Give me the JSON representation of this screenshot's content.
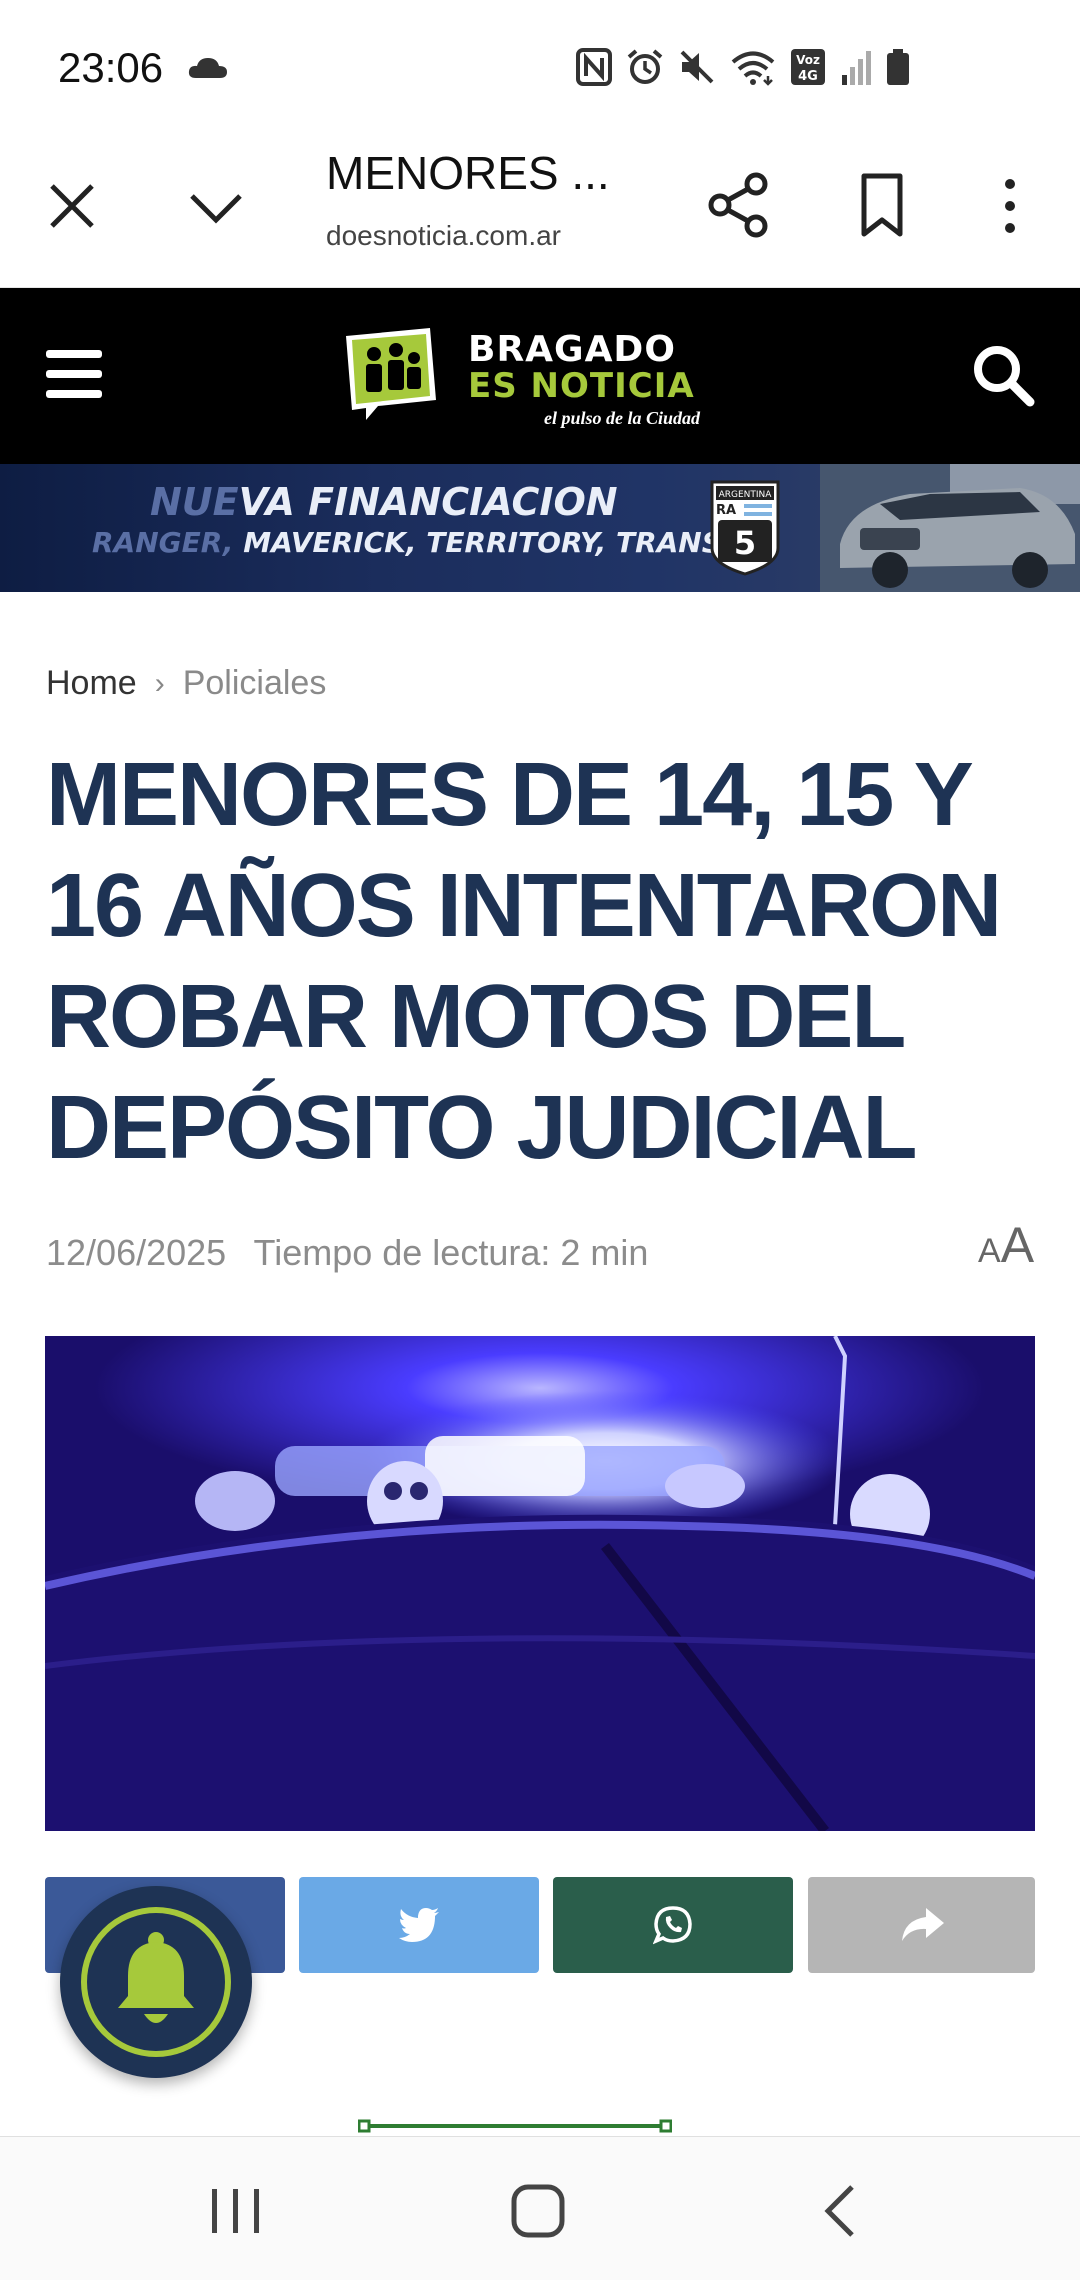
{
  "status_bar": {
    "time": "23:06",
    "icons": [
      "cloud-icon",
      "nfc-icon",
      "alarm-icon",
      "mute-icon",
      "wifi-icon",
      "volte-4g-icon",
      "signal-icon",
      "battery-icon"
    ],
    "volte_text": "Voz 4G"
  },
  "browser": {
    "title": "MENORES ...",
    "url": "doesnoticia.com.ar"
  },
  "site": {
    "logo_name": "BRAGADO",
    "logo_sub": "ES NOTICIA",
    "logo_tagline": "el pulso de la Ciudad",
    "brand_color": "#a6c93b",
    "header_color": "#000000"
  },
  "ad": {
    "line1_fade": "NUE",
    "line1": "VA FINANCIACION",
    "line2_fade": "RANGER, ",
    "line2": "MAVERICK, TERRITORY, TRANSIT",
    "route_country": "ARGENTINA",
    "route_code": "RA",
    "route_number": "5"
  },
  "breadcrumb": {
    "home": "Home",
    "separator": "›",
    "category": "Policiales"
  },
  "article": {
    "headline": "MENORES DE 14, 15 Y 16 AÑOS INTENTARON ROBAR MOTOS DEL DEPÓSITO JUDICIAL",
    "date": "12/06/2025",
    "reading_time": "Tiempo de lectura: 2 min",
    "font_toggle_small": "A",
    "font_toggle_big": "A",
    "headline_color": "#1e3354"
  },
  "share": {
    "buttons": [
      "facebook",
      "twitter",
      "whatsapp",
      "share"
    ],
    "colors": {
      "facebook": "#3b5998",
      "twitter": "#6aa9e6",
      "whatsapp": "#2a5e4b",
      "share": "#b5b5b5"
    }
  },
  "nav_bar": {
    "buttons": [
      "recents",
      "home",
      "back"
    ]
  }
}
